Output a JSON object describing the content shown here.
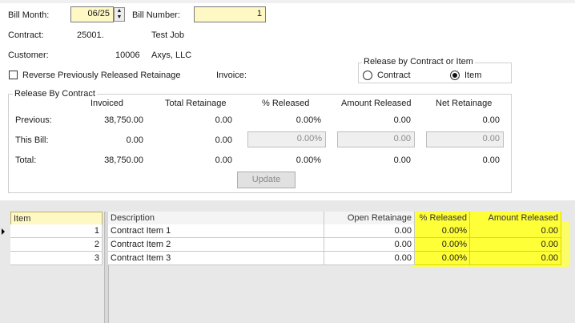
{
  "header": {
    "bill_month_label": "Bill Month:",
    "bill_month_value": "06/25",
    "bill_number_label": "Bill Number:",
    "bill_number_value": "1",
    "contract_label": "Contract:",
    "contract_number": "25001.",
    "contract_name": "Test Job",
    "customer_label": "Customer:",
    "customer_number": "10006",
    "customer_name": "Axys, LLC",
    "reverse_label": "Reverse Previously Released Retainage",
    "reverse_checked": false,
    "invoice_label": "Invoice:"
  },
  "release_by": {
    "title": "Release by Contract or Item",
    "option_contract": "Contract",
    "option_item": "Item",
    "selected": "Item"
  },
  "release_by_contract": {
    "title": "Release By Contract",
    "columns": [
      "Invoiced",
      "Total Retainage",
      "% Released",
      "Amount Released",
      "Net Retainage"
    ],
    "rows": [
      {
        "label": "Previous:",
        "invoiced": "38,750.00",
        "total_retainage": "0.00",
        "pct_released": "0.00%",
        "amount_released": "0.00",
        "net_retainage": "0.00"
      },
      {
        "label": "This Bill:",
        "invoiced": "0.00",
        "total_retainage": "0.00",
        "pct_released": "0.00%",
        "amount_released": "0.00",
        "net_retainage": "0.00"
      },
      {
        "label": "Total:",
        "invoiced": "38,750.00",
        "total_retainage": "0.00",
        "pct_released": "0.00%",
        "amount_released": "0.00",
        "net_retainage": "0.00"
      }
    ],
    "update_label": "Update"
  },
  "grid": {
    "headers": {
      "item": "Item",
      "description": "Description",
      "open_retainage": "Open Retainage",
      "pct_released": "% Released",
      "amount_released": "Amount Released"
    },
    "rows": [
      {
        "item": "1",
        "description": "Contract Item 1",
        "open_retainage": "0.00",
        "pct_released": "0.00%",
        "amount_released": "0.00"
      },
      {
        "item": "2",
        "description": "Contract Item 2",
        "open_retainage": "0.00",
        "pct_released": "0.00%",
        "amount_released": "0.00"
      },
      {
        "item": "3",
        "description": "Contract Item 3",
        "open_retainage": "0.00",
        "pct_released": "0.00%",
        "amount_released": "0.00"
      }
    ]
  },
  "colors": {
    "field_bg": "#fdf8c4",
    "highlight": "#ffff38"
  }
}
